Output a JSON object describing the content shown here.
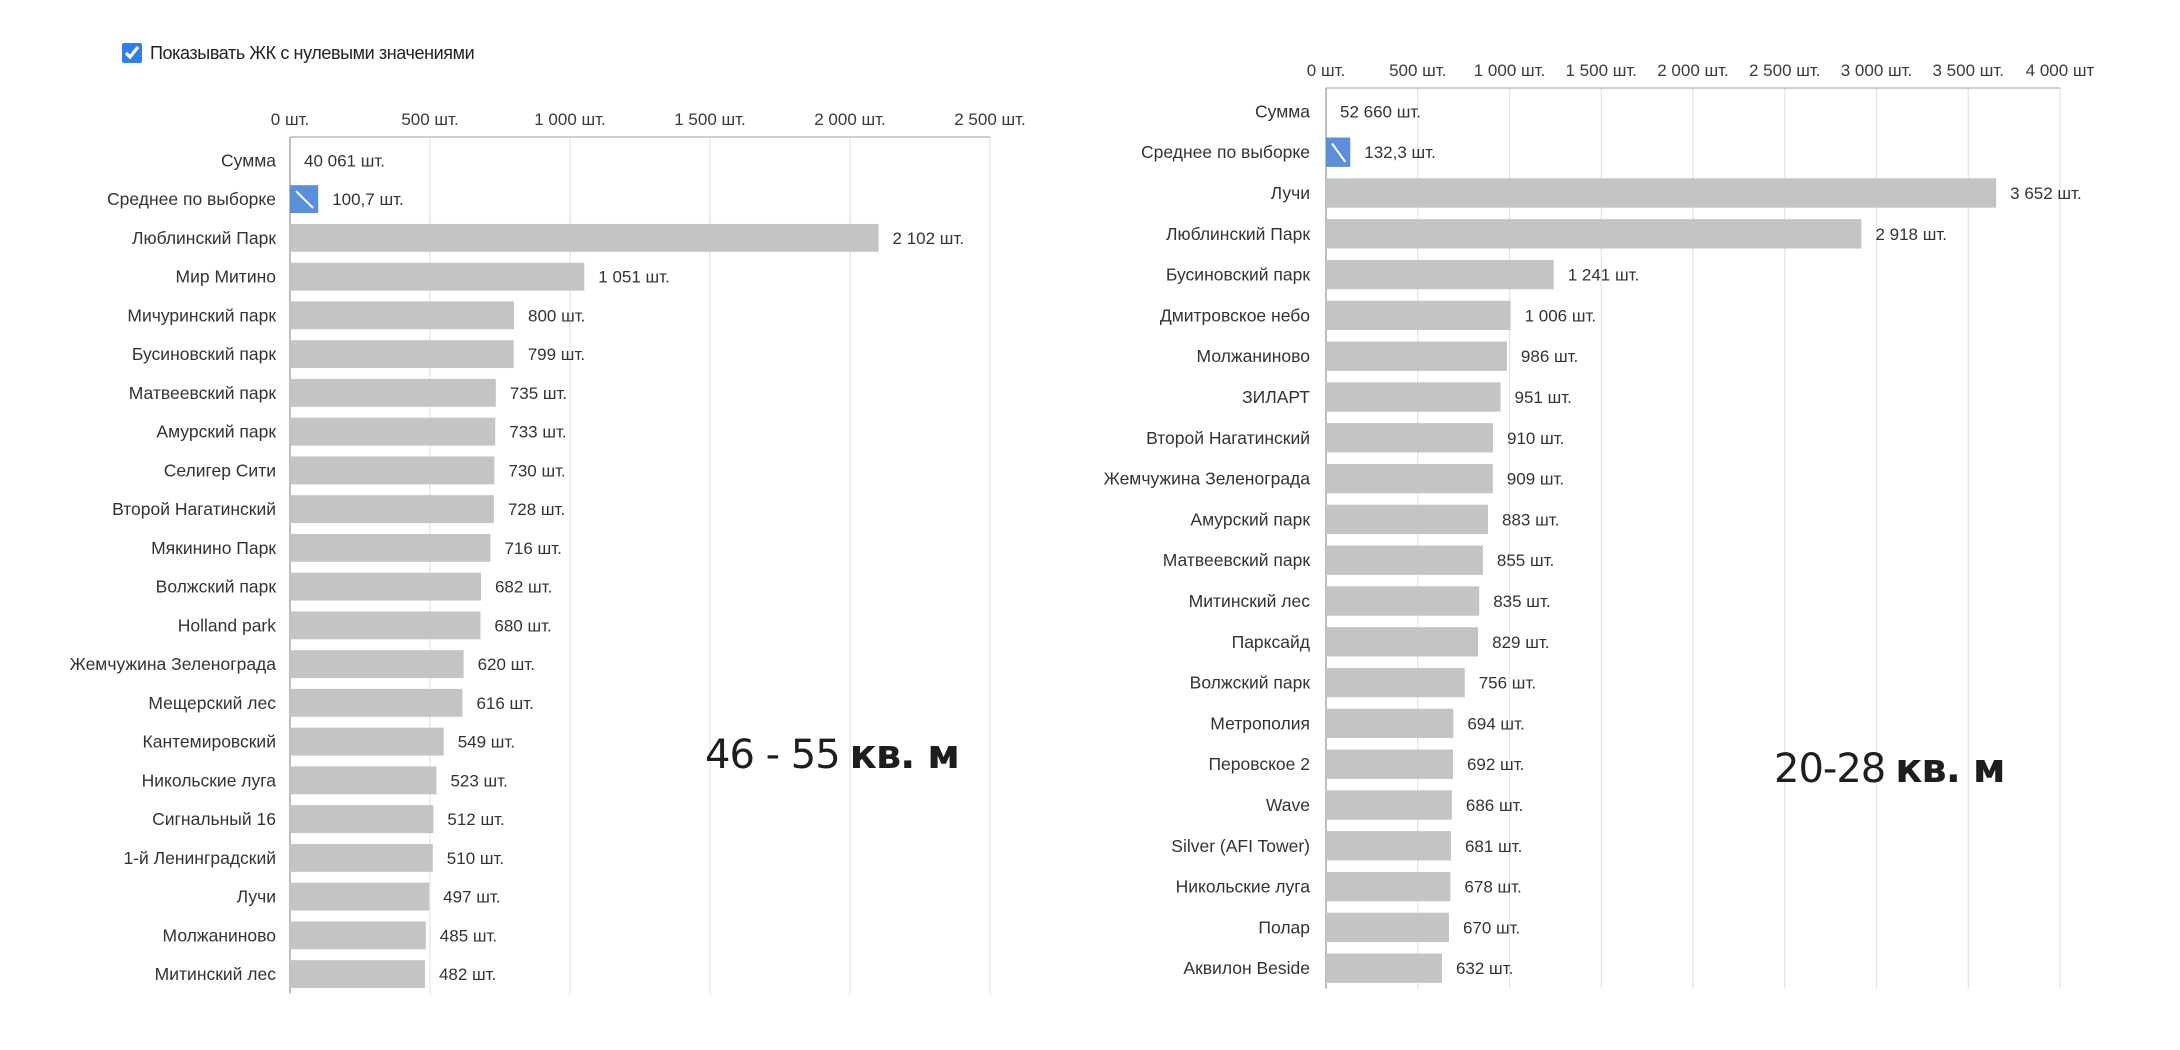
{
  "filter": {
    "show_zero_label": "Показывать ЖК с нулевыми значениями",
    "show_zero_checked": true
  },
  "charts": {
    "left": {
      "range": "46 - 55",
      "unit": "кв. м"
    },
    "right": {
      "range": "20-28",
      "unit": "кв. м"
    }
  },
  "colors": {
    "bar": "#c4c4c4",
    "average_bar": "#5b8fdc",
    "grid": "#e3e3e3",
    "axis": "#bdbdbd"
  },
  "chart_data": [
    {
      "type": "bar",
      "orientation": "horizontal",
      "title": "",
      "xlim": [
        0,
        2500
      ],
      "xticks": [
        0,
        500,
        1000,
        1500,
        2000,
        2500
      ],
      "tick_labels": [
        "0 шт.",
        "500 шт.",
        "1 000 шт.",
        "1 500 шт.",
        "2 000 шт.",
        "2 500 шт."
      ],
      "grid": true,
      "summary_rows": [
        {
          "label": "Сумма",
          "value_label": "40 061 шт."
        },
        {
          "label": "Среднее по выборке",
          "value": 100.7,
          "value_label": "100,7 шт.",
          "highlight": true
        }
      ],
      "categories": [
        "Люблинский Парк",
        "Мир Митино",
        "Мичуринский парк",
        "Бусиновский парк",
        "Матвеевский парк",
        "Амурский парк",
        "Селигер Сити",
        "Второй Нагатинский",
        "Мякинино Парк",
        "Волжский парк",
        "Holland park",
        "Жемчужина Зеленограда",
        "Мещерский лес",
        "Кантемировский",
        "Никольские луга",
        "Сигнальный 16",
        "1-й Ленинградский",
        "Лучи",
        "Молжаниново",
        "Митинский лес"
      ],
      "values": [
        2102,
        1051,
        800,
        799,
        735,
        733,
        730,
        728,
        716,
        682,
        680,
        620,
        616,
        549,
        523,
        512,
        510,
        497,
        485,
        482
      ],
      "value_labels": [
        "2 102 шт.",
        "1 051 шт.",
        "800 шт.",
        "799 шт.",
        "735 шт.",
        "733 шт.",
        "730 шт.",
        "728 шт.",
        "716 шт.",
        "682 шт.",
        "680 шт.",
        "620 шт.",
        "616 шт.",
        "549 шт.",
        "523 шт.",
        "512 шт.",
        "510 шт.",
        "497 шт.",
        "485 шт.",
        "482 шт."
      ]
    },
    {
      "type": "bar",
      "orientation": "horizontal",
      "title": "",
      "xlim": [
        0,
        4000
      ],
      "xticks": [
        0,
        500,
        1000,
        1500,
        2000,
        2500,
        3000,
        3500,
        4000
      ],
      "tick_labels": [
        "0 шт.",
        "500 шт.",
        "1 000 шт.",
        "1 500 шт.",
        "2 000 шт.",
        "2 500 шт.",
        "3 000 шт.",
        "3 500 шт.",
        "4 000 шт"
      ],
      "grid": true,
      "summary_rows": [
        {
          "label": "Сумма",
          "value_label": "52 660 шт."
        },
        {
          "label": "Среднее по выборке",
          "value": 132.3,
          "value_label": "132,3 шт.",
          "highlight": true
        }
      ],
      "categories": [
        "Лучи",
        "Люблинский Парк",
        "Бусиновский парк",
        "Дмитровское небо",
        "Молжаниново",
        "ЗИЛАРТ",
        "Второй Нагатинский",
        "Жемчужина Зеленограда",
        "Амурский парк",
        "Матвеевский парк",
        "Митинский лес",
        "Парксайд",
        "Волжский парк",
        "Метрополия",
        "Перовское 2",
        "Wave",
        "Silver (AFI Tower)",
        "Никольские луга",
        "Полар",
        "Аквилон Beside"
      ],
      "values": [
        3652,
        2918,
        1241,
        1006,
        986,
        951,
        910,
        909,
        883,
        855,
        835,
        829,
        756,
        694,
        692,
        686,
        681,
        678,
        670,
        632
      ],
      "value_labels": [
        "3 652 шт.",
        "2 918 шт.",
        "1 241 шт.",
        "1 006 шт.",
        "986 шт.",
        "951 шт.",
        "910 шт.",
        "909 шт.",
        "883 шт.",
        "855 шт.",
        "835 шт.",
        "829 шт.",
        "756 шт.",
        "694 шт.",
        "692 шт.",
        "686 шт.",
        "681 шт.",
        "678 шт.",
        "670 шт.",
        "632 шт."
      ]
    }
  ]
}
